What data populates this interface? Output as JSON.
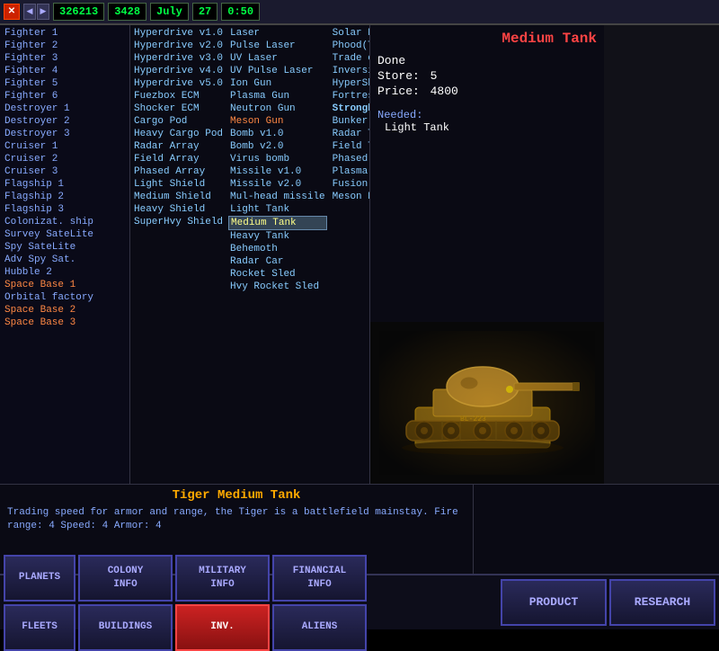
{
  "topbar": {
    "money": "326213",
    "production": "3428",
    "month": "July",
    "day": "27",
    "time": "0:50"
  },
  "title": "Medium Tank",
  "info": {
    "done": "Done",
    "store_label": "Store:",
    "store_value": "5",
    "price_label": "Price:",
    "price_value": "4800",
    "needed_label": "Needed:",
    "needed_value": "Light Tank"
  },
  "desc_title": "Tiger Medium Tank",
  "desc_text": "Trading speed for armor and range, the Tiger is a battlefield mainstay. Fire range: 4  Speed: 4  Armor: 4",
  "ships": [
    {
      "label": "Fighter 1",
      "selected": false
    },
    {
      "label": "Fighter 2",
      "selected": false
    },
    {
      "label": "Fighter 3",
      "selected": false
    },
    {
      "label": "Fighter 4",
      "selected": false
    },
    {
      "label": "Fighter 5",
      "selected": false
    },
    {
      "label": "Fighter 6",
      "selected": false
    },
    {
      "label": "Destroyer 1",
      "selected": false
    },
    {
      "label": "Destroyer 2",
      "selected": false
    },
    {
      "label": "Destroyer 3",
      "selected": false
    },
    {
      "label": "Cruiser 1",
      "selected": false
    },
    {
      "label": "Cruiser 2",
      "selected": false
    },
    {
      "label": "Cruiser 3",
      "selected": false
    },
    {
      "label": "Flagship 1",
      "selected": false
    },
    {
      "label": "Flagship 2",
      "selected": false
    },
    {
      "label": "Flagship 3",
      "selected": false
    },
    {
      "label": "Colonizat. ship",
      "selected": false
    },
    {
      "label": "Survey SateLite",
      "selected": false
    },
    {
      "label": "Spy SateLite",
      "selected": false
    },
    {
      "label": "Adv Spy Sat.",
      "selected": false
    },
    {
      "label": "Hubble 2",
      "selected": false
    },
    {
      "label": "Space Base 1",
      "selected": false
    },
    {
      "label": "Orbital factory",
      "selected": false
    },
    {
      "label": "Space Base 2",
      "selected": false
    },
    {
      "label": "Space Base 3",
      "selected": false
    }
  ],
  "col1_items": [
    {
      "label": "Hyperdrive v1.0"
    },
    {
      "label": "Hyperdrive v2.0"
    },
    {
      "label": "Hyperdrive v3.0"
    },
    {
      "label": "Hyperdrive v4.0"
    },
    {
      "label": "Hyperdrive v5.0"
    },
    {
      "label": "Fuezbox ECM"
    },
    {
      "label": "Shocker ECM"
    },
    {
      "label": "Cargo Pod"
    },
    {
      "label": "Heavy Cargo Pod"
    },
    {
      "label": "Radar Array"
    },
    {
      "label": "Field Array"
    },
    {
      "label": "Phased Array"
    },
    {
      "label": "Light Shield"
    },
    {
      "label": "Medium Shield"
    },
    {
      "label": "Heavy Shield"
    },
    {
      "label": "SuperHvy Shield"
    }
  ],
  "col2_items": [
    {
      "label": "Laser"
    },
    {
      "label": "Pulse Laser"
    },
    {
      "label": "UV Laser"
    },
    {
      "label": "UV Pulse Laser"
    },
    {
      "label": "Ion Gun"
    },
    {
      "label": "Plasma Gun"
    },
    {
      "label": "Neutron Gun"
    },
    {
      "label": "Meson Gun",
      "highlight": true
    },
    {
      "label": "Bomb v1.0"
    },
    {
      "label": "Bomb v2.0"
    },
    {
      "label": "Virus bomb"
    },
    {
      "label": "Missile v1.0"
    },
    {
      "label": "Missile v2.0"
    },
    {
      "label": "Mul-head missile"
    },
    {
      "label": "Light Tank"
    },
    {
      "label": "Medium Tank",
      "selected": true
    },
    {
      "label": "Heavy Tank"
    },
    {
      "label": "Behemoth"
    },
    {
      "label": "Radar Car"
    },
    {
      "label": "Rocket Sled"
    },
    {
      "label": "Hvy Rocket Sled"
    }
  ],
  "col3_items": [
    {
      "label": "Solar Plant"
    },
    {
      "label": "Phood(TM) Factory"
    },
    {
      "label": "Trade centre"
    },
    {
      "label": "Inversion Shield"
    },
    {
      "label": "HyperShield"
    },
    {
      "label": "Fortress"
    },
    {
      "label": "Stronghold",
      "bold": true
    },
    {
      "label": "Bunker"
    },
    {
      "label": "Radar Telescope"
    },
    {
      "label": "Field Telescope"
    },
    {
      "label": "Phased Telescope"
    },
    {
      "label": "Plasma Projector"
    },
    {
      "label": "Fusion Projector"
    },
    {
      "label": "Meson Projector"
    }
  ],
  "bottom_buttons": {
    "row1": [
      {
        "label": "PLANETS",
        "active": false
      },
      {
        "label": "COLONY\nINFO",
        "active": false
      },
      {
        "label": "MILITARY\nINFO",
        "active": false
      },
      {
        "label": "FINANCIAL\nINFO",
        "active": false
      }
    ],
    "row2": [
      {
        "label": "FLEETS",
        "active": false
      },
      {
        "label": "BUILDINGS",
        "active": false
      },
      {
        "label": "INV.",
        "active": true
      },
      {
        "label": "ALIENS",
        "active": false
      }
    ],
    "right": [
      {
        "label": "PRODUCT",
        "active": false
      },
      {
        "label": "RESEARCH",
        "active": false
      }
    ]
  }
}
